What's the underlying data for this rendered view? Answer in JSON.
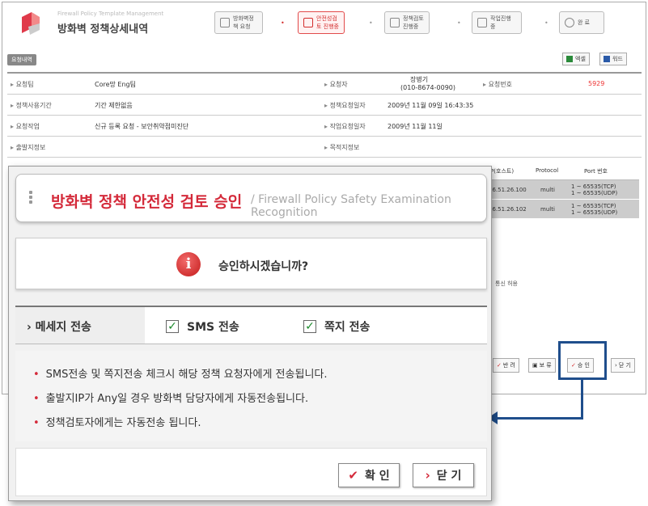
{
  "app": {
    "subtitle": "Firewall Policy Template Management",
    "title": "방화벽 정책상세내역"
  },
  "steps": [
    {
      "label": "방화벽정책 요청"
    },
    {
      "label": "안전성검토 진행중"
    },
    {
      "label": "정책검토 진행중"
    },
    {
      "label": "작업진행중"
    },
    {
      "label": "완 료"
    }
  ],
  "section_tag": "요청내역",
  "top_buttons": {
    "excel": "엑셀",
    "word": "워드"
  },
  "info": {
    "requester_team_label": "요청팀",
    "requester_team_value": "Core망 Eng팀",
    "requester_label": "요청자",
    "requester_value_name": "장병기",
    "requester_value_phone": "(010-8674-0090)",
    "request_no_label": "요청번호",
    "request_no_value": "5929",
    "policy_period_label": "정책사용기간",
    "policy_period_value": "기간 제한없음",
    "policy_request_date_label": "정책요청일자",
    "policy_request_date_value": "2009년 11월 09일 16:43:35",
    "request_task_label": "요청작업",
    "request_task_value": "신규 등록 요청 - 보안취약점미진단",
    "task_request_date_label": "작업요청일자",
    "task_request_date_value": "2009년 11월 11일",
    "source_label": "출발지정보",
    "destination_label": "목적지정보"
  },
  "port_table": {
    "headers": [
      "IP(호스트)",
      "Protocol",
      "Port 번호"
    ],
    "rows": [
      {
        "ip": "06.51.26.100",
        "protocol": "multi",
        "port1": "1 ~ 65535(TCP)",
        "port2": "1 ~ 65535(UDP)"
      },
      {
        "ip": "06.51.26.102",
        "protocol": "multi",
        "port1": "1 ~ 65535(TCP)",
        "port2": "1 ~ 65535(UDP)"
      }
    ]
  },
  "bg_note": "통신 허용",
  "bottom_buttons": {
    "reject": "반 려",
    "hold": "보 류",
    "approve": "승 인",
    "close": "닫 기"
  },
  "dialog": {
    "title_ko": "방화벽 정책 안전성 검토 승인",
    "title_en": "/ Firewall Policy Safety Examination Recognition",
    "confirm_text": "승인하시겠습니까?",
    "message_label": "메세지 전송",
    "sms_label": "SMS 전송",
    "note_label": "쪽지 전송",
    "notes": [
      "SMS전송 및 쪽지전송 체크시 해당 정책 요청자에게 전송됩니다.",
      "출발지IP가 Any일 경우 방화벽 담당자에게 자동전송됩니다.",
      "정책검토자에게는 자동전송 됩니다."
    ],
    "confirm_button": "확 인",
    "close_button": "닫 기"
  },
  "colors": {
    "accent": "#d42a3a",
    "highlight": "#1f4e8c"
  },
  "icons": [
    "logo-icon",
    "info-icon",
    "checkbox-checked-icon",
    "check-icon",
    "chevron-right-icon",
    "arrow-left-icon"
  ]
}
